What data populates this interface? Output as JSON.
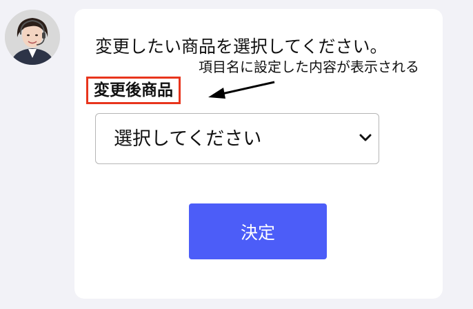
{
  "chat": {
    "prompt": "変更したい商品を選択してください。",
    "annotation": "項目名に設定した内容が表示される",
    "field_label": "変更後商品",
    "select": {
      "selected": "選択してください"
    },
    "submit_label": "決定"
  },
  "colors": {
    "background": "#f2f2f7",
    "card": "#ffffff",
    "highlight_border": "#e8341c",
    "button": "#4c5df8"
  },
  "icons": {
    "avatar": "operator-avatar",
    "arrow": "arrow-left-icon",
    "chevron": "chevron-down-icon"
  }
}
